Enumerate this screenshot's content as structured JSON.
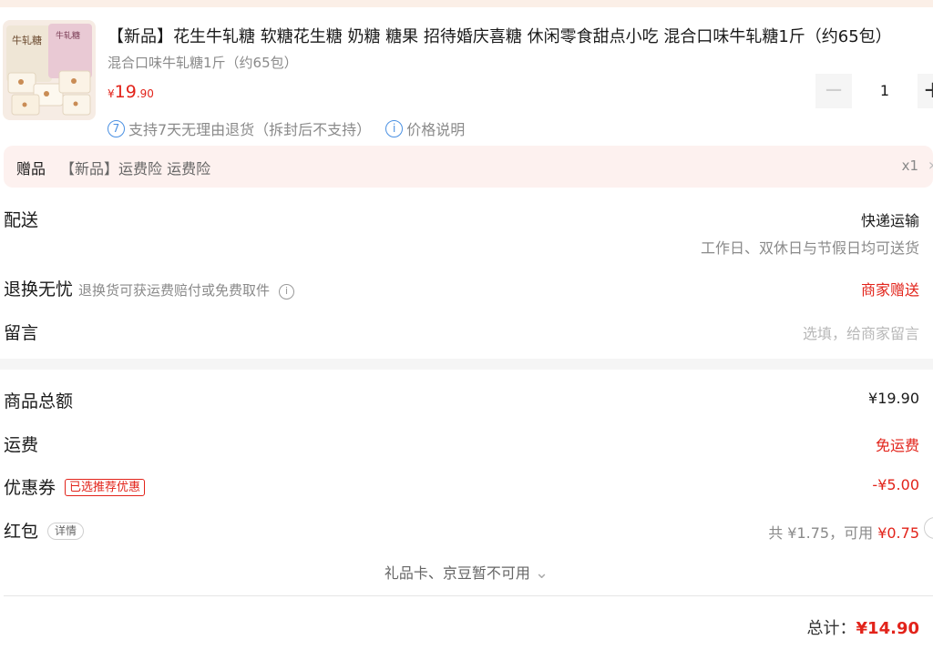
{
  "product": {
    "title": "【新品】花生牛轧糖 软糖花生糖 奶糖 糖果 招待婚庆喜糖 休闲零食甜点小吃 混合口味牛轧糖1斤（约65包）",
    "spec": "混合口味牛轧糖1斤（约65包）",
    "price_currency": "¥",
    "price_int": "19",
    "price_dec": ".90",
    "quantity": "1",
    "minus_label": "−",
    "plus_label": "+",
    "service_1_icon": "7",
    "service_1": "支持7天无理由退货（拆封后不支持）",
    "service_2_icon": "i",
    "service_2": "价格说明",
    "package_label_1": "牛轧糖",
    "package_label_2": "牛轧糖"
  },
  "gift": {
    "tag": "赠品",
    "text": "【新品】运费险 运费险",
    "qty": "x1",
    "arrow": "›"
  },
  "delivery": {
    "label": "配送",
    "method": "快递运输",
    "note": "工作日、双休日与节假日均可送货"
  },
  "returns": {
    "label": "退换无忧",
    "note": "退换货可获运费赔付或免费取件",
    "info_icon": "i",
    "value": "商家赠送"
  },
  "message": {
    "label": "留言",
    "placeholder": "选填，给商家留言"
  },
  "summary": {
    "subtotal_label": "商品总额",
    "subtotal_value": "¥19.90",
    "shipping_label": "运费",
    "shipping_value": "免运费",
    "coupon_label": "优惠券",
    "coupon_tag": "已选推荐优惠",
    "coupon_value": "-¥5.00",
    "redpacket_label": "红包",
    "redpacket_tag": "详情",
    "redpacket_total_prefix": "共 ¥1.75，可用 ",
    "redpacket_usable": "¥0.75",
    "unusable_text": "礼品卡、京豆暂不可用",
    "unusable_arrow": "⌄"
  },
  "total": {
    "label": "总计：",
    "value": "¥14.90"
  },
  "colors": {
    "accent_red": "#e2231a",
    "gift_bg": "#fdf1ef",
    "info_blue": "#4a90e2"
  }
}
